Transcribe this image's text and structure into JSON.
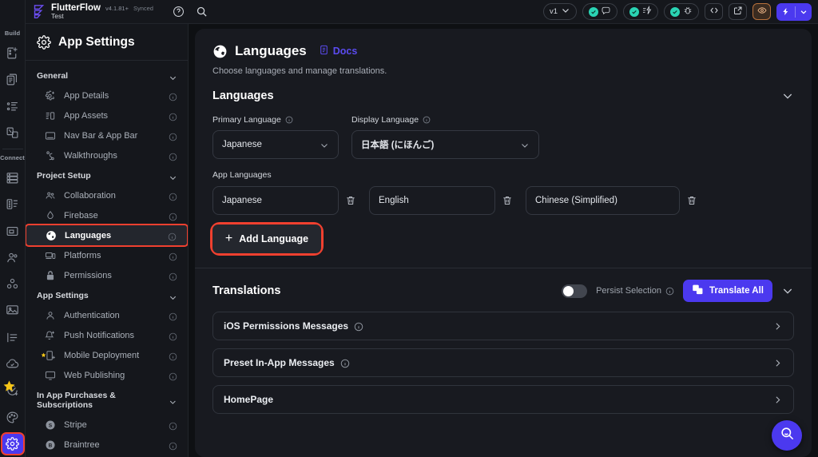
{
  "topbar": {
    "logo_icon": "flutterflow-logo-icon",
    "brand_name": "FlutterFlow",
    "version": "v4.1.81+",
    "sync_status": "Synced",
    "project_name": "Test",
    "help_icon": "help-circle-icon",
    "search_icon": "search-icon",
    "version_selector": "v1",
    "comments_badge_icon": "comment-icon",
    "performance_badge_icon": "lightning-check-icon",
    "debug_badge_icon": "bug-icon",
    "code_icon": "code-brackets-icon",
    "open_external_icon": "external-link-icon",
    "preview_icon": "eye-icon",
    "run_icon": "bolt-icon",
    "run_dropdown_icon": "chevron-down-icon"
  },
  "rail": {
    "groups": [
      {
        "label": "Build",
        "items": [
          {
            "icon": "add-page-icon",
            "name": "rail-item-page-selector"
          },
          {
            "icon": "widget-tree-icon",
            "name": "rail-item-widget-tree"
          },
          {
            "icon": "widget-palette-icon",
            "name": "rail-item-widget-palette"
          },
          {
            "icon": "components-icon",
            "name": "rail-item-components"
          }
        ]
      },
      {
        "label": "Connect",
        "items": [
          {
            "icon": "database-icon",
            "name": "rail-item-firestore"
          },
          {
            "icon": "api-list-icon",
            "name": "rail-item-api-calls"
          },
          {
            "icon": "app-state-icon",
            "name": "rail-item-app-state"
          },
          {
            "icon": "users-icon",
            "name": "rail-item-authentication"
          },
          {
            "icon": "integrations-icon",
            "name": "rail-item-integrations"
          },
          {
            "icon": "media-icon",
            "name": "rail-item-media-assets"
          },
          {
            "icon": "localization-icon",
            "name": "rail-item-localization"
          },
          {
            "icon": "cloud-check-icon",
            "name": "rail-item-deploy"
          },
          {
            "icon": "tests-icon",
            "name": "rail-item-tests"
          },
          {
            "icon": "theme-palette-icon",
            "name": "rail-item-theme"
          },
          {
            "icon": "settings-gear-icon",
            "name": "rail-item-settings",
            "active": true
          }
        ]
      }
    ]
  },
  "navpanel": {
    "header_icon": "settings-gear-icon",
    "header_title": "App Settings",
    "sections": [
      {
        "label": "General",
        "chevron": "chevron-down-icon",
        "items": [
          {
            "icon": "app-details-icon",
            "label": "App Details",
            "info": "info-icon"
          },
          {
            "icon": "app-assets-icon",
            "label": "App Assets",
            "info": "info-icon"
          },
          {
            "icon": "nav-bar-icon",
            "label": "Nav Bar & App Bar",
            "info": "info-icon"
          },
          {
            "icon": "walkthrough-icon",
            "label": "Walkthroughs",
            "info": "info-icon"
          }
        ]
      },
      {
        "label": "Project Setup",
        "chevron": "chevron-down-icon",
        "items": [
          {
            "icon": "collaboration-icon",
            "label": "Collaboration",
            "info": "info-icon"
          },
          {
            "icon": "firebase-icon",
            "label": "Firebase",
            "info": "info-icon"
          },
          {
            "icon": "globe-icon",
            "label": "Languages",
            "info": "info-icon",
            "selected": true
          },
          {
            "icon": "platforms-icon",
            "label": "Platforms",
            "info": "info-icon"
          },
          {
            "icon": "lock-icon",
            "label": "Permissions",
            "info": "info-icon"
          }
        ]
      },
      {
        "label": "App Settings",
        "chevron": "chevron-down-icon",
        "items": [
          {
            "icon": "person-icon",
            "label": "Authentication",
            "info": "info-icon"
          },
          {
            "icon": "bell-plus-icon",
            "label": "Push Notifications",
            "info": "info-icon"
          },
          {
            "icon": "mobile-deploy-icon",
            "label": "Mobile Deployment",
            "info": "info-icon",
            "star": true
          },
          {
            "icon": "monitor-icon",
            "label": "Web Publishing",
            "info": "info-icon"
          }
        ]
      },
      {
        "label": "In App Purchases & Subscriptions",
        "chevron": "chevron-down-icon",
        "items": [
          {
            "icon": "stripe-icon",
            "label": "Stripe",
            "info": "info-icon"
          },
          {
            "icon": "braintree-icon",
            "label": "Braintree",
            "info": "info-icon"
          }
        ]
      }
    ]
  },
  "main": {
    "title_icon": "globe-icon",
    "title": "Languages",
    "docs_icon": "docs-file-icon",
    "docs_label": "Docs",
    "subtitle": "Choose languages and manage translations.",
    "languages_section": {
      "heading": "Languages",
      "collapse_icon": "chevron-down-icon",
      "primary_language": {
        "label": "Primary Language",
        "info": "info-icon",
        "value": "Japanese",
        "chevron": "chevron-down-icon"
      },
      "display_language": {
        "label": "Display Language",
        "info": "info-icon",
        "value": "日本語 (にほんご)",
        "chevron": "chevron-down-icon"
      },
      "app_languages_label": "App Languages",
      "app_languages": [
        {
          "value": "Japanese",
          "delete_icon": "trash-icon"
        },
        {
          "value": "English",
          "delete_icon": "trash-icon"
        },
        {
          "value": "Chinese (Simplified)",
          "delete_icon": "trash-icon"
        }
      ],
      "add_language_button": "Add Language",
      "add_language_icon": "plus-icon"
    },
    "translations_section": {
      "heading": "Translations",
      "persist_label": "Persist Selection",
      "persist_info": "info-icon",
      "persist_enabled": false,
      "translate_all_label": "Translate All",
      "translate_icon": "google-translate-icon",
      "collapse_icon": "chevron-down-icon",
      "rows": [
        {
          "label": "iOS Permissions Messages",
          "info": "info-icon",
          "arrow": "chevron-right-icon"
        },
        {
          "label": "Preset In-App Messages",
          "info": "info-icon",
          "arrow": "chevron-right-icon"
        },
        {
          "label": "HomePage",
          "info": null,
          "arrow": "chevron-right-icon"
        }
      ]
    },
    "fab_icon": "search-icon"
  },
  "colors": {
    "accent_purple": "#4b39ef",
    "highlight_red": "#f0402f",
    "success_teal": "#2ad4b4",
    "panel_bg": "#181a20",
    "app_bg": "#0e1013",
    "sidebar_bg": "#15171c"
  }
}
